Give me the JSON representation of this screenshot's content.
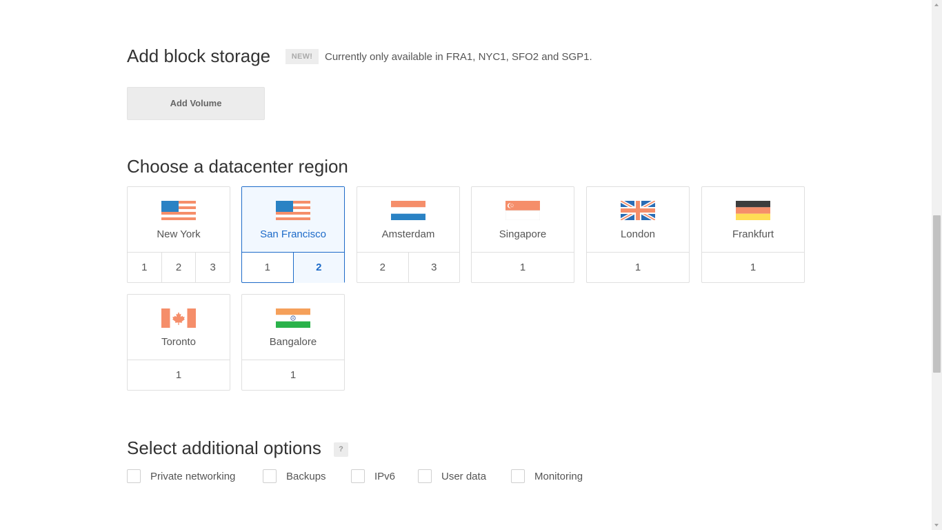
{
  "block_storage": {
    "title": "Add block storage",
    "badge": "NEW!",
    "note": "Currently only available in FRA1, NYC1, SFO2 and SGP1.",
    "add_volume_label": "Add Volume"
  },
  "datacenter": {
    "title": "Choose a datacenter region",
    "selected_region": "San Francisco",
    "selected_number": "2",
    "regions": [
      {
        "name": "New York",
        "flag": "us-flag-icon",
        "numbers": [
          "1",
          "2",
          "3"
        ]
      },
      {
        "name": "San Francisco",
        "flag": "us-flag-icon",
        "numbers": [
          "1",
          "2"
        ]
      },
      {
        "name": "Amsterdam",
        "flag": "netherlands-flag-icon",
        "numbers": [
          "2",
          "3"
        ]
      },
      {
        "name": "Singapore",
        "flag": "singapore-flag-icon",
        "numbers": [
          "1"
        ]
      },
      {
        "name": "London",
        "flag": "uk-flag-icon",
        "numbers": [
          "1"
        ]
      },
      {
        "name": "Frankfurt",
        "flag": "germany-flag-icon",
        "numbers": [
          "1"
        ]
      },
      {
        "name": "Toronto",
        "flag": "canada-flag-icon",
        "numbers": [
          "1"
        ]
      },
      {
        "name": "Bangalore",
        "flag": "india-flag-icon",
        "numbers": [
          "1"
        ]
      }
    ]
  },
  "options": {
    "title": "Select additional options",
    "help": "?",
    "items": [
      {
        "label": "Private networking",
        "checked": false
      },
      {
        "label": "Backups",
        "checked": false
      },
      {
        "label": "IPv6",
        "checked": false
      },
      {
        "label": "User data",
        "checked": false
      },
      {
        "label": "Monitoring",
        "checked": false
      }
    ]
  },
  "colors": {
    "accent": "#1c6ac8",
    "selected_bg": "#f2f8ff",
    "border": "#dfdfdf"
  }
}
